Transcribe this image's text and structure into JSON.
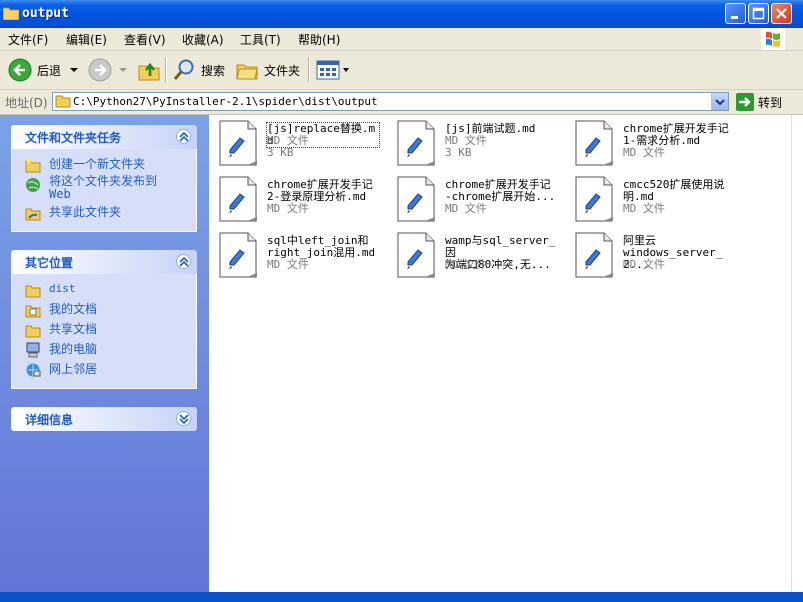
{
  "window": {
    "title": "output"
  },
  "menu": [
    {
      "label": "文件(F)"
    },
    {
      "label": "编辑(E)"
    },
    {
      "label": "查看(V)"
    },
    {
      "label": "收藏(A)"
    },
    {
      "label": "工具(T)"
    },
    {
      "label": "帮助(H)"
    }
  ],
  "toolbar": {
    "back": "后退",
    "search": "搜索",
    "folders": "文件夹"
  },
  "address": {
    "label": "地址(D)",
    "path": "C:\\Python27\\PyInstaller-2.1\\spider\\dist\\output",
    "go": "转到"
  },
  "panels": {
    "tasks": {
      "title": "文件和文件夹任务",
      "items": [
        {
          "label": "创建一个新文件夹"
        },
        {
          "label": "将这个文件夹发布到",
          "sub": "Web"
        },
        {
          "label": "共享此文件夹"
        }
      ]
    },
    "places": {
      "title": "其它位置",
      "items": [
        {
          "label": "dist"
        },
        {
          "label": "我的文档"
        },
        {
          "label": "共享文档"
        },
        {
          "label": "我的电脑"
        },
        {
          "label": "网上邻居"
        }
      ]
    },
    "details": {
      "title": "详细信息"
    }
  },
  "files": [
    {
      "name": "[js]replace替换.md",
      "type": "MD 文件",
      "size": "3 KB"
    },
    {
      "name": "[js]前端试题.md",
      "type": "MD 文件",
      "size": "3 KB"
    },
    {
      "name": "chrome扩展开发手记\n1-需求分析.md",
      "type": "MD 文件"
    },
    {
      "name": "chrome扩展开发手记\n2-登录原理分析.md",
      "type": "MD 文件"
    },
    {
      "name": "chrome扩展开发手记\n-chrome扩展开始...",
      "type": "MD 文件"
    },
    {
      "name": "cmcc520扩展使用说\n明.md",
      "type": "MD 文件"
    },
    {
      "name": "sql中left_join和\nright_join混用.md",
      "type": "MD 文件"
    },
    {
      "name": "wamp与sql_server_因\n为端口80冲突,无...",
      "type": "MD 文件"
    },
    {
      "name": "阿里云\nwindows_server_2...",
      "type": "MD 文件"
    }
  ]
}
